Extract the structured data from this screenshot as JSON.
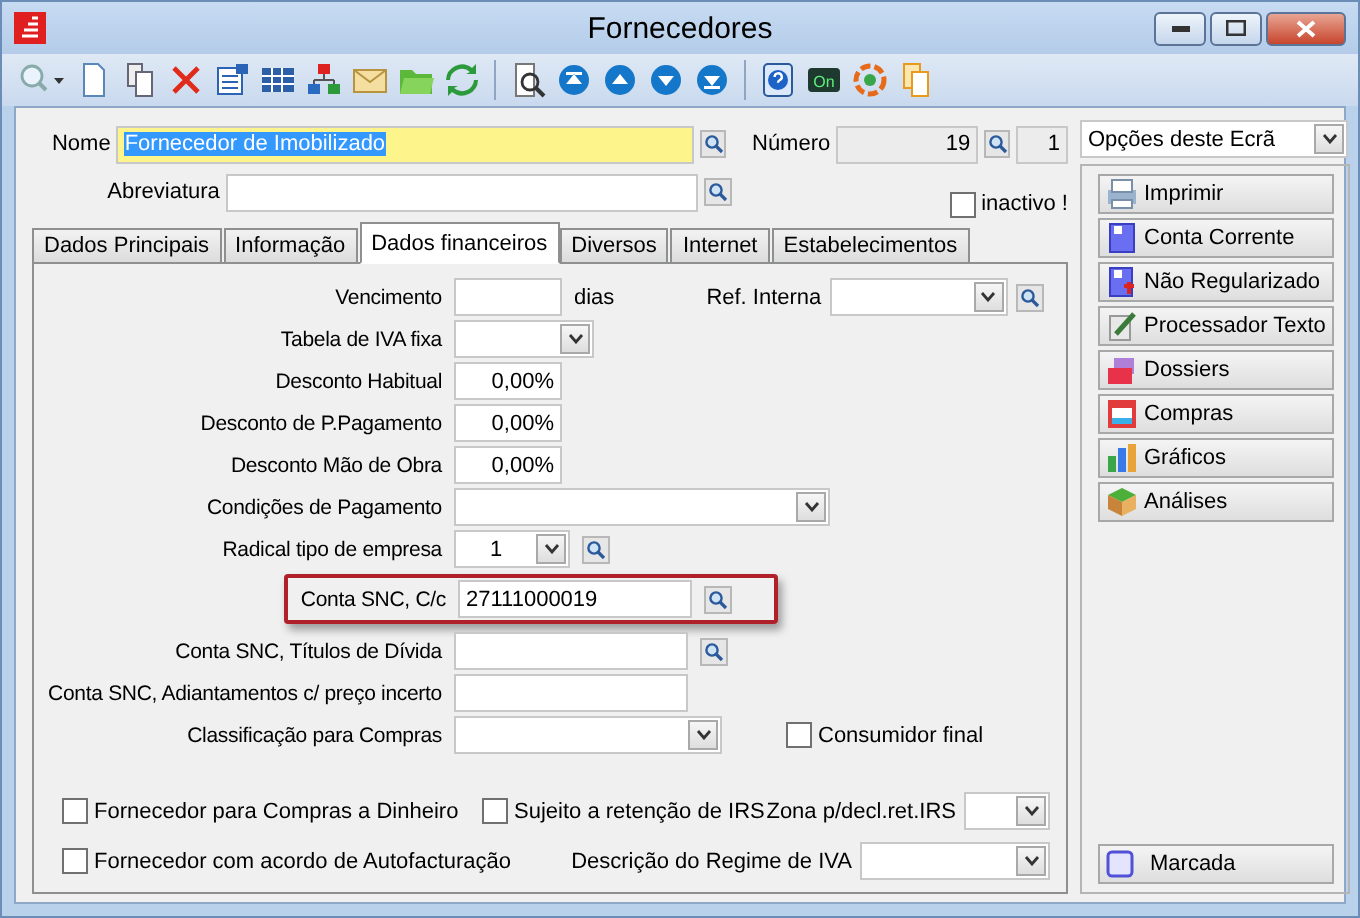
{
  "window": {
    "title": "Fornecedores"
  },
  "toolbar": {
    "badge_label": "On"
  },
  "header": {
    "nome": {
      "label": "Nome",
      "value": "Fornecedor de Imobilizado"
    },
    "numero": {
      "label": "Número",
      "value": "19",
      "sub_value": "1"
    },
    "abreviatura": {
      "label": "Abreviatura"
    },
    "inactivo": {
      "label": "inactivo !",
      "checked": false
    }
  },
  "tabs": [
    {
      "label": "Dados Principais",
      "selected": false
    },
    {
      "label": "Informação",
      "selected": false
    },
    {
      "label": "Dados financeiros",
      "selected": true
    },
    {
      "label": "Diversos",
      "selected": false
    },
    {
      "label": "Internet",
      "selected": false
    },
    {
      "label": "Estabelecimentos",
      "selected": false
    }
  ],
  "fields": [
    {
      "kind": "days",
      "label": "Vencimento",
      "suffix": "dias",
      "highlighted": false,
      "aside": {
        "kind": "select_lookup",
        "label": "Ref. Interna"
      }
    },
    {
      "kind": "short_select",
      "label": "Tabela de IVA fixa",
      "highlighted": false
    },
    {
      "kind": "percent",
      "label": "Desconto Habitual",
      "value": "0,00%",
      "highlighted": false
    },
    {
      "kind": "percent",
      "label": "Desconto de P.Pagamento",
      "value": "0,00%",
      "highlighted": false
    },
    {
      "kind": "percent",
      "label": "Desconto Mão de Obra",
      "value": "0,00%",
      "highlighted": false
    },
    {
      "kind": "long_select",
      "label": "Condições de Pagamento",
      "highlighted": false
    },
    {
      "kind": "small_select",
      "label": "Radical tipo de empresa",
      "value": "1",
      "highlighted": false
    },
    {
      "kind": "account",
      "label": "Conta SNC, C/c",
      "value": "27111000019",
      "highlighted": true
    },
    {
      "kind": "account",
      "label": "Conta SNC, Títulos de Dívida",
      "highlighted": false
    },
    {
      "kind": "text",
      "label": "Conta SNC, Adiantamentos c/ preço incerto",
      "highlighted": false
    },
    {
      "kind": "medium_select",
      "label": "Classificação para Compras",
      "highlighted": false,
      "aside": {
        "kind": "checkbox",
        "label": "Consumidor final",
        "checked": false
      }
    }
  ],
  "bottom": [
    {
      "checkbox": {
        "label": "Fornecedor para Compras a Dinheiro",
        "checked": false
      },
      "middle_checkbox": {
        "label": "Sujeito a retenção de IRS",
        "checked": false
      },
      "select": {
        "label": "Zona p/decl.ret.IRS",
        "kind": "narrow"
      }
    },
    {
      "checkbox": {
        "label": "Fornecedor com acordo de Autofacturação",
        "checked": false
      },
      "select": {
        "label": "Descrição do Regime de IVA",
        "kind": "wide"
      }
    }
  ],
  "side_panel": {
    "select": {
      "value": "Opções deste Ecrã"
    },
    "options": [
      {
        "label": "Imprimir"
      },
      {
        "label": "Conta Corrente"
      },
      {
        "label": "Não Regularizado"
      },
      {
        "label": "Processador Texto"
      },
      {
        "label": "Dossiers"
      },
      {
        "label": "Compras"
      },
      {
        "label": "Gráficos"
      },
      {
        "label": "Análises"
      }
    ],
    "marked": {
      "label": "Marcada"
    }
  }
}
